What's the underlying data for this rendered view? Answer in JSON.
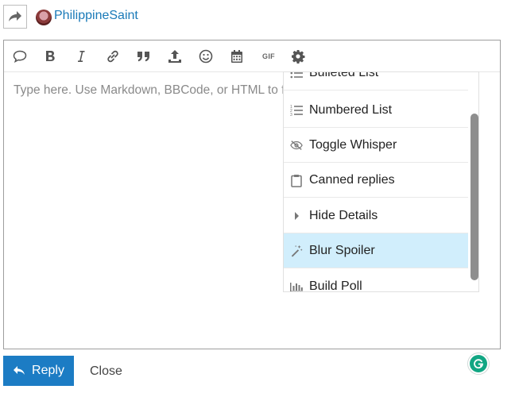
{
  "header": {
    "username": "PhilippineSaint"
  },
  "toolbar": {
    "gif_label": "GIF",
    "buttons": [
      "speech-bubble-icon",
      "bold-icon",
      "italic-icon",
      "link-icon",
      "quote-icon",
      "upload-icon",
      "emoji-icon",
      "calendar-icon",
      "gif-button",
      "gear-icon"
    ]
  },
  "editor": {
    "placeholder": "Type here. Use Markdown, BBCode, or HTML to format."
  },
  "menu": {
    "items": [
      {
        "label": "Bulleted List",
        "icon": "bulleted-list-icon"
      },
      {
        "label": "Numbered List",
        "icon": "numbered-list-icon"
      },
      {
        "label": "Toggle Whisper",
        "icon": "eye-slash-icon"
      },
      {
        "label": "Canned replies",
        "icon": "clipboard-icon"
      },
      {
        "label": "Hide Details",
        "icon": "caret-right-icon"
      },
      {
        "label": "Blur Spoiler",
        "icon": "magic-wand-icon",
        "active": true
      },
      {
        "label": "Build Poll",
        "icon": "bar-chart-icon"
      }
    ],
    "highlight_color": "#d1eefc"
  },
  "footer": {
    "reply_label": "Reply",
    "close_label": "Close"
  },
  "colors": {
    "accent": "#1c7cc4",
    "username": "#1a7ab8"
  }
}
